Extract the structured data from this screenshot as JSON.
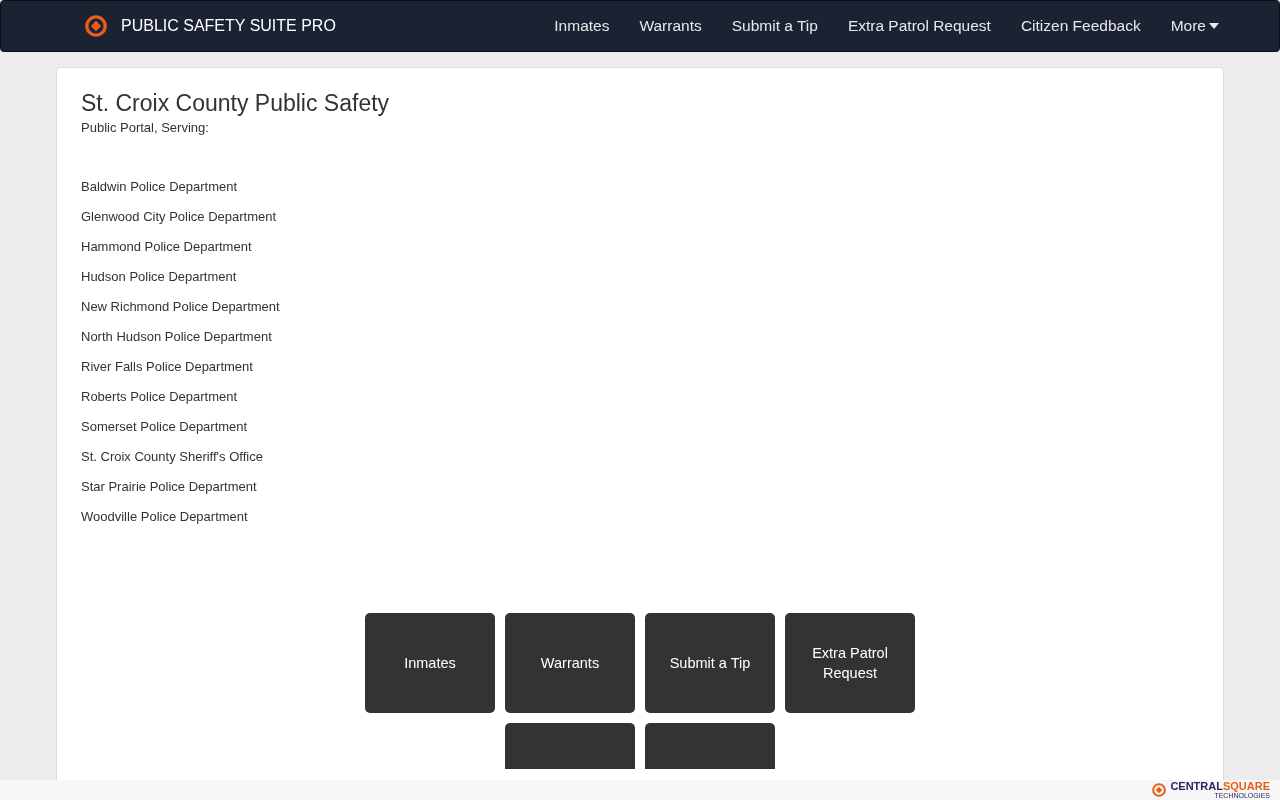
{
  "brand": {
    "name": "PUBLIC SAFETY SUITE PRO"
  },
  "nav": [
    {
      "label": "Inmates"
    },
    {
      "label": "Warrants"
    },
    {
      "label": "Submit a Tip"
    },
    {
      "label": "Extra Patrol Request"
    },
    {
      "label": "Citizen Feedback"
    },
    {
      "label": "More",
      "kind": "dropdown"
    }
  ],
  "title": "St. Croix County Public Safety",
  "subtitle": "Public Portal, Serving:",
  "agencies": [
    "Baldwin Police Department",
    "Glenwood City Police Department",
    "Hammond Police Department",
    "Hudson Police Department",
    "New Richmond Police Department",
    "North Hudson Police Department",
    "River Falls Police Department",
    "Roberts Police Department",
    "Somerset Police Department",
    "St. Croix County Sheriff's Office",
    "Star Prairie Police Department",
    "Woodville Police Department"
  ],
  "tiles": [
    {
      "label": "Inmates"
    },
    {
      "label": "Warrants"
    },
    {
      "label": "Submit a Tip"
    },
    {
      "label": "Extra Patrol Request"
    },
    {
      "kind": "cut"
    },
    {
      "kind": "cut"
    }
  ],
  "footer": {
    "logo_main": "CENTRAL",
    "logo_accent": "SQUARE",
    "logo_sub": "TECHNOLOGIES"
  }
}
